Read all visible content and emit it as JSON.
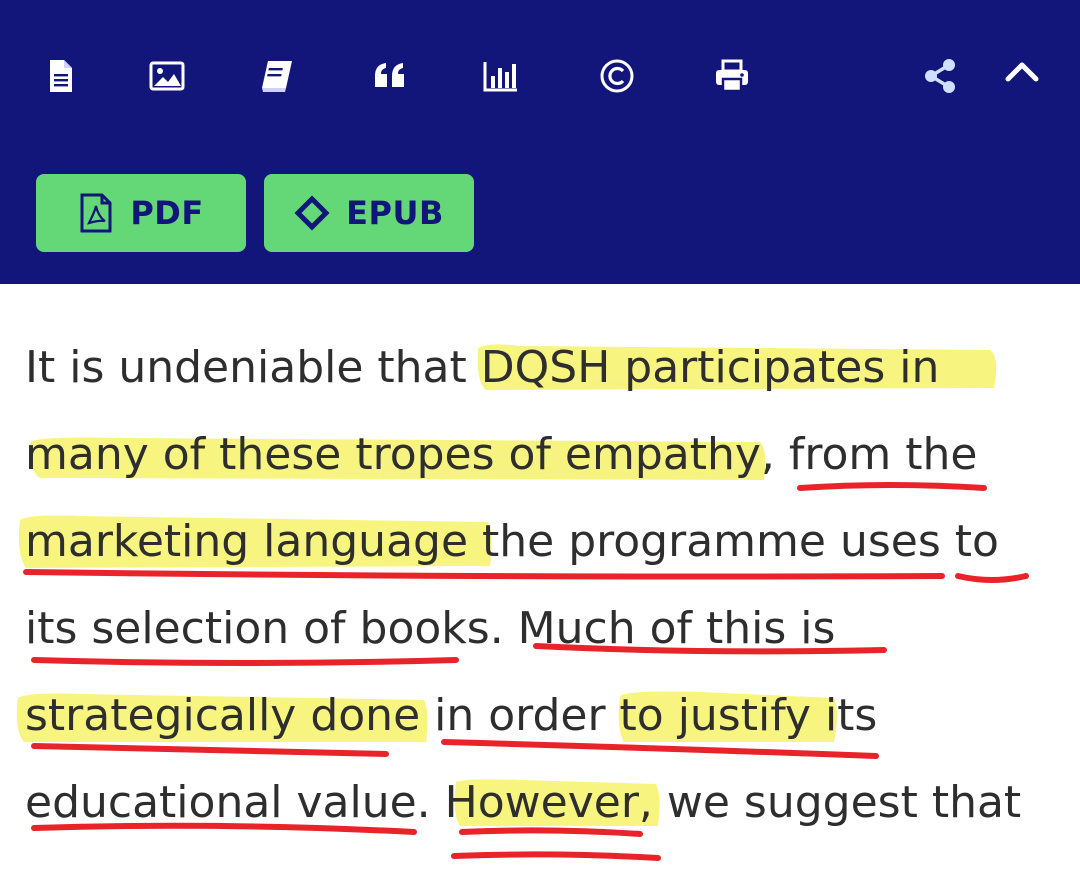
{
  "toolbar": {
    "icons": [
      "document-icon",
      "image-icon",
      "book-icon",
      "quote-icon",
      "bar-chart-icon",
      "copyright-icon",
      "print-icon",
      "share-icon",
      "chevron-up-icon"
    ],
    "pdf_label": "PDF",
    "epub_label": "EPUB"
  },
  "article": {
    "lines": [
      "It is undeniable that DQSH participates in",
      "many of these tropes of empathy, from the",
      "marketing language the programme uses to",
      "its selection of books. Much of this is",
      "strategically done in order to justify its",
      "educational value. However, we suggest that"
    ]
  },
  "colors": {
    "header_bg": "#12157a",
    "button_bg": "#64d877",
    "highlight": "#f6f26a",
    "underline": "#e8242a",
    "text": "#2e2e2e"
  }
}
